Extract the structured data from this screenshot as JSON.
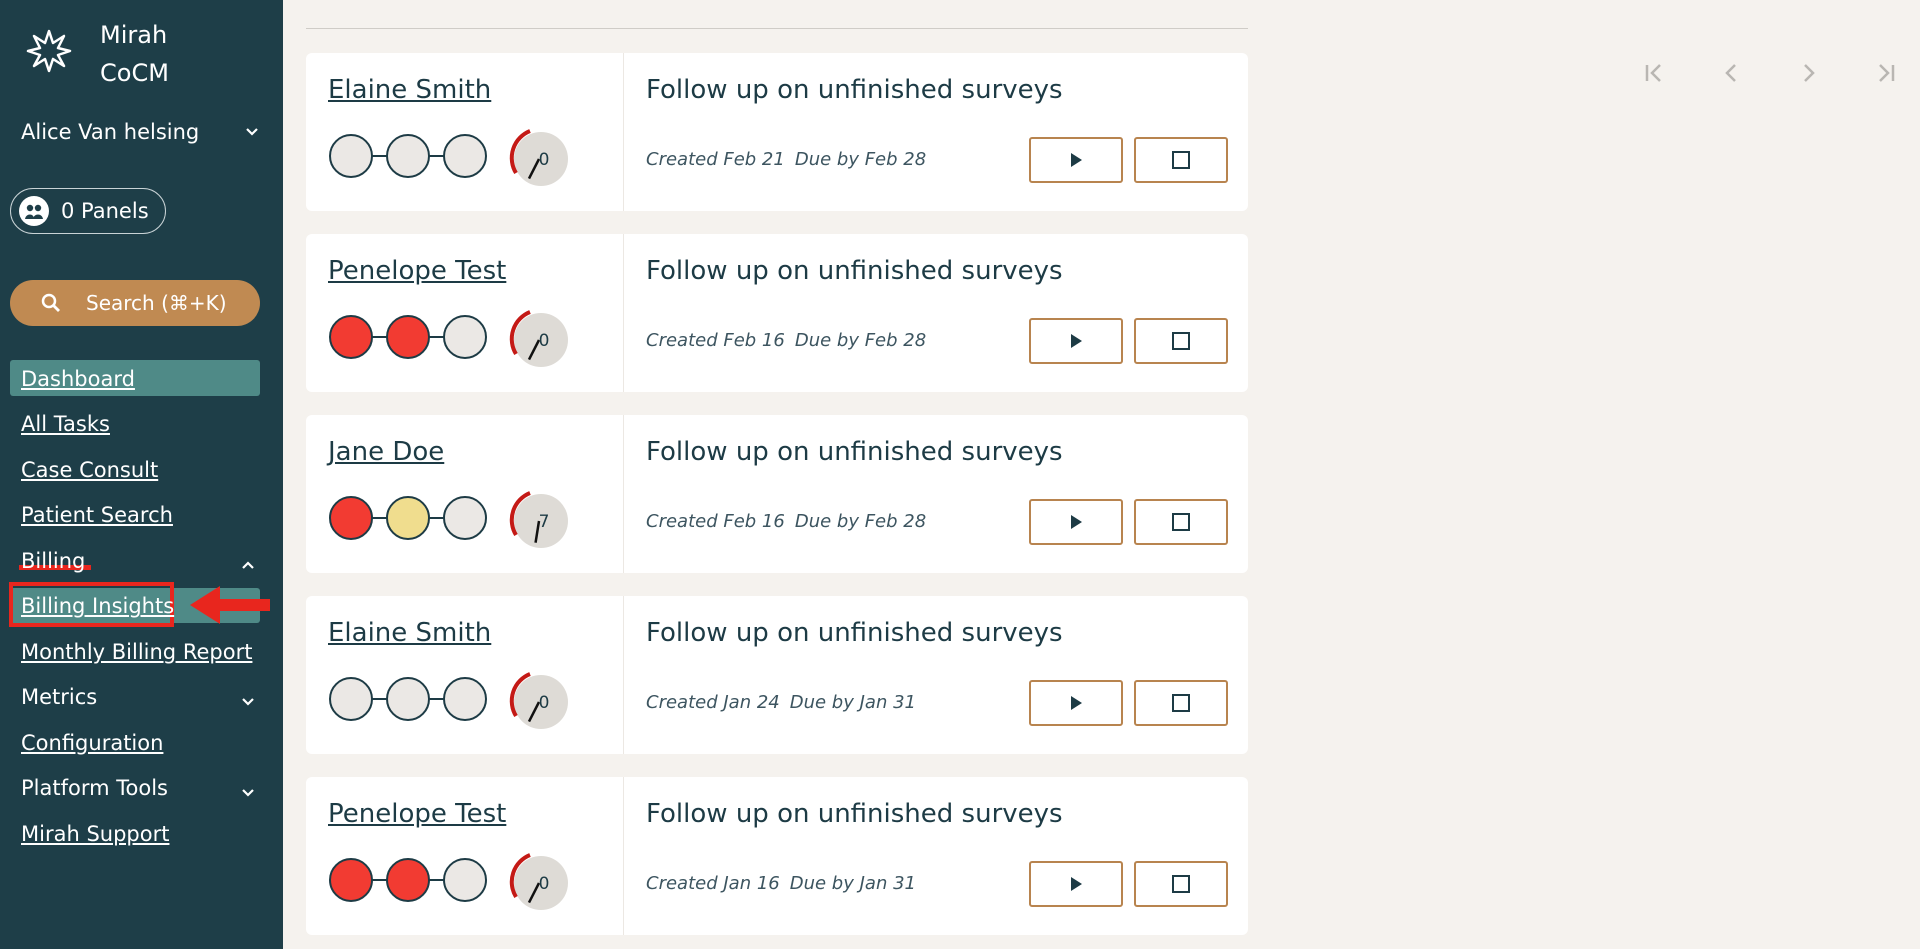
{
  "app": {
    "brand_line1": "Mirah",
    "brand_line2": "CoCM"
  },
  "user": {
    "name": "Alice Van helsing"
  },
  "panels": {
    "label": "0 Panels"
  },
  "search": {
    "label": "Search  (⌘+K)"
  },
  "nav": {
    "dashboard": "Dashboard",
    "all_tasks": "All Tasks",
    "case_consult": "Case Consult",
    "patient_search": "Patient Search",
    "billing": "Billing",
    "billing_insights": "Billing Insights",
    "monthly_billing_report": "Monthly Billing Report",
    "metrics": "Metrics",
    "configuration": "Configuration",
    "platform_tools": "Platform Tools",
    "mirah_support": "Mirah Support"
  },
  "tasks": [
    {
      "patient": "Elaine Smith",
      "dots": [
        "empty",
        "empty",
        "empty"
      ],
      "score": "0",
      "gauge_level": 0.15,
      "title": "Follow up on unfinished surveys",
      "created": "Created Feb 21",
      "due": "Due by Feb 28"
    },
    {
      "patient": "Penelope Test",
      "dots": [
        "red",
        "red",
        "empty"
      ],
      "score": "0",
      "gauge_level": 0.15,
      "title": "Follow up on unfinished surveys",
      "created": "Created Feb 16",
      "due": "Due by Feb 28"
    },
    {
      "patient": "Jane Doe",
      "dots": [
        "red",
        "yellow",
        "empty"
      ],
      "score": "7",
      "gauge_level": 0.3,
      "title": "Follow up on unfinished surveys",
      "created": "Created Feb 16",
      "due": "Due by Feb 28"
    },
    {
      "patient": "Elaine Smith",
      "dots": [
        "empty",
        "empty",
        "empty"
      ],
      "score": "0",
      "gauge_level": 0.15,
      "title": "Follow up on unfinished surveys",
      "created": "Created Jan 24",
      "due": "Due by Jan 31"
    },
    {
      "patient": "Penelope Test",
      "dots": [
        "red",
        "red",
        "empty"
      ],
      "score": "0",
      "gauge_level": 0.15,
      "title": "Follow up on unfinished surveys",
      "created": "Created Jan 16",
      "due": "Due by Jan 31"
    }
  ],
  "colors": {
    "sidebar": "#1e3e48",
    "active_nav": "#4f8a87",
    "search": "#c08a52",
    "red_dot": "#f23b32",
    "yellow_dot": "#f0dd8e",
    "empty_dot": "#ebe8e5",
    "button_border": "#b8844f",
    "annotation": "#e8261e"
  }
}
